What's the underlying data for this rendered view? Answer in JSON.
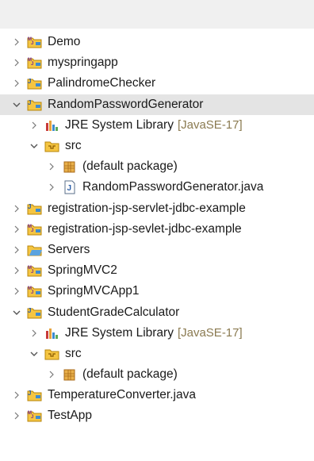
{
  "tree": {
    "items": [
      {
        "label": "Demo",
        "level": 0,
        "expanded": false,
        "icon": "maven-project-icon"
      },
      {
        "label": "myspringapp",
        "level": 0,
        "expanded": false,
        "icon": "maven-project-icon"
      },
      {
        "label": "PalindromeChecker",
        "level": 0,
        "expanded": false,
        "icon": "java-project-icon"
      },
      {
        "label": "RandomPasswordGenerator",
        "level": 0,
        "expanded": true,
        "selected": true,
        "icon": "java-project-icon"
      },
      {
        "label": "JRE System Library",
        "decoration": "[JavaSE-17]",
        "level": 1,
        "expanded": false,
        "icon": "library-icon"
      },
      {
        "label": "src",
        "level": 1,
        "expanded": true,
        "icon": "source-folder-icon"
      },
      {
        "label": "(default package)",
        "level": 2,
        "expanded": false,
        "icon": "package-icon"
      },
      {
        "label": "RandomPasswordGenerator.java",
        "level": 2,
        "expanded": false,
        "icon": "java-file-icon"
      },
      {
        "label": "registration-jsp-servlet-jdbc-example",
        "level": 0,
        "expanded": false,
        "icon": "java-project-icon"
      },
      {
        "label": "registration-jsp-sevlet-jdbc-example",
        "level": 0,
        "expanded": false,
        "icon": "maven-project-icon"
      },
      {
        "label": "Servers",
        "level": 0,
        "expanded": false,
        "icon": "folder-project-icon"
      },
      {
        "label": "SpringMVC2",
        "level": 0,
        "expanded": false,
        "icon": "maven-project-icon"
      },
      {
        "label": "SpringMVCApp1",
        "level": 0,
        "expanded": false,
        "icon": "maven-project-icon"
      },
      {
        "label": "StudentGradeCalculator",
        "level": 0,
        "expanded": true,
        "icon": "java-project-icon"
      },
      {
        "label": "JRE System Library",
        "decoration": "[JavaSE-17]",
        "level": 1,
        "expanded": false,
        "icon": "library-icon"
      },
      {
        "label": "src",
        "level": 1,
        "expanded": true,
        "icon": "source-folder-icon"
      },
      {
        "label": "(default package)",
        "level": 2,
        "expanded": false,
        "icon": "package-icon"
      },
      {
        "label": "TemperatureConverter.java",
        "level": 0,
        "expanded": false,
        "icon": "java-project-icon"
      },
      {
        "label": "TestApp",
        "level": 0,
        "expanded": false,
        "icon": "maven-project-icon"
      }
    ]
  },
  "colors": {
    "selection": "#e4e4e4",
    "decoration": "#8a7a50",
    "folder": "#f5c542",
    "folder_outline": "#b8860b",
    "chevron": "#777777"
  }
}
